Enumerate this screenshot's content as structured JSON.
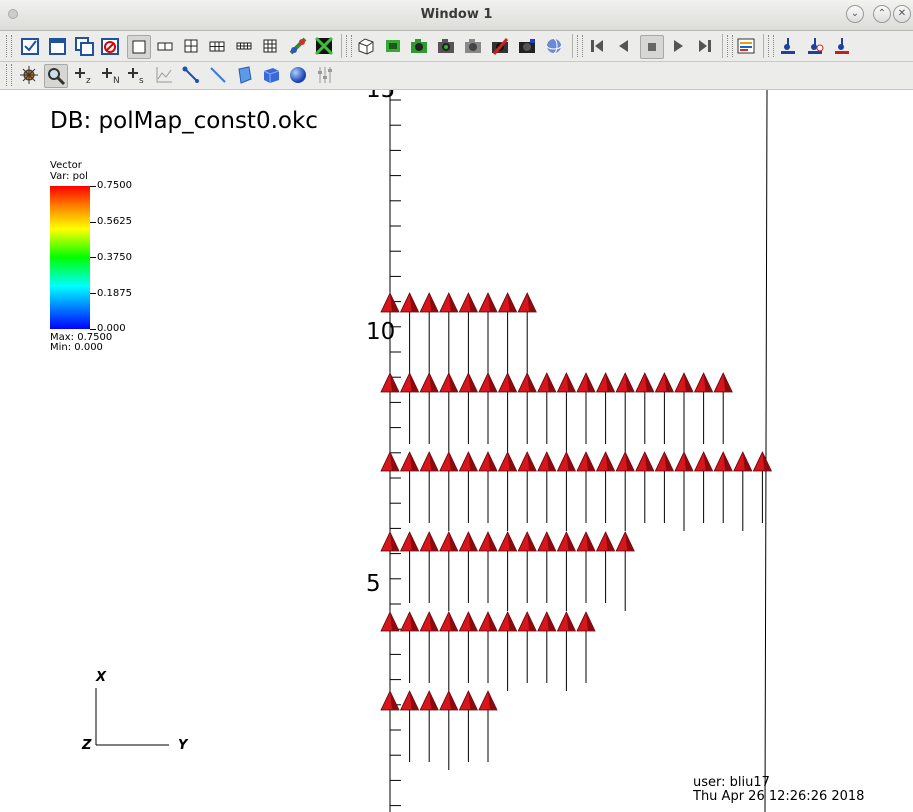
{
  "window": {
    "title": "Window 1"
  },
  "toolbar1": {
    "items": [
      "checkbox-icon",
      "new-window-icon",
      "copy-window-icon",
      "clear-window-icon",
      "layout-1x1-icon",
      "layout-1x2-icon",
      "layout-2x2-icon",
      "layout-2x3-icon",
      "layout-2x4-icon",
      "layout-3x3-icon",
      "lock-view-icon",
      "lock-time-icon",
      "reset-view-icon",
      "draw-plots-icon",
      "camera-icon",
      "camera-grey-icon",
      "camera-remove-icon",
      "camera-save-icon",
      "spin-icon",
      "reverse-step-icon",
      "reverse-play-icon",
      "stop-icon",
      "play-icon",
      "step-forward-icon",
      "annotation-icon",
      "lighting-icon",
      "pick-icon",
      "query-icon"
    ]
  },
  "toolbar2": {
    "items": [
      "navigate-icon",
      "zoom-icon",
      "zone-pick-icon",
      "node-pick-icon",
      "spreadsheet-pick-icon",
      "curve-icon",
      "lineout-icon",
      "line-tool-icon",
      "plane-tool-icon",
      "box-tool-icon",
      "sphere-tool-icon",
      "slider-icon"
    ]
  },
  "plot": {
    "db_label": "DB: polMap_const0.okc",
    "legend": {
      "title_line1": "Vector",
      "title_line2": "Var: pol",
      "ticks": [
        "0.7500",
        "0.5625",
        "0.3750",
        "0.1875",
        "0.000"
      ],
      "max_label": "Max:  0.7500",
      "min_label": "Min:  0.000"
    },
    "axis_triad": {
      "x": "X",
      "y": "Y",
      "z": "Z"
    },
    "axis_ticks": {
      "top": "15",
      "middle": "10",
      "bottom": "5"
    },
    "vector_color": "#d8141c",
    "rows": [
      {
        "count": 8,
        "tail_from": 8,
        "tail_to": 10.0
      },
      {
        "count": 18,
        "tail_from": 6,
        "tail_to": 10.6
      },
      {
        "count": 20,
        "tail_from": 4,
        "tail_to": 8.4
      },
      {
        "count": 13,
        "tail_from": 2,
        "tail_to": 6.2
      },
      {
        "count": 11,
        "tail_from": 0,
        "tail_to": 4.2
      },
      {
        "count": 6,
        "tail_from": -2,
        "tail_to": 2.2
      }
    ]
  },
  "footer": {
    "user": "user: bliu17",
    "timestamp": "Thu Apr 26 12:26:26 2018"
  }
}
